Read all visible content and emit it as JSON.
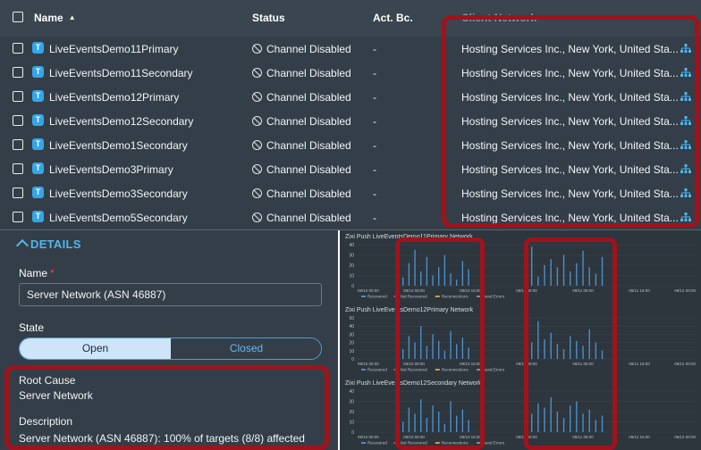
{
  "table": {
    "columns": {
      "name": "Name",
      "status": "Status",
      "act": "Act. Bc.",
      "network": "Client Network"
    },
    "rows": [
      {
        "name": "LiveEventsDemo11Primary",
        "status": "Channel Disabled",
        "act": "-",
        "network": "Hosting Services Inc., New York, United Sta..."
      },
      {
        "name": "LiveEventsDemo11Secondary",
        "status": "Channel Disabled",
        "act": "-",
        "network": "Hosting Services Inc., New York, United Sta..."
      },
      {
        "name": "LiveEventsDemo12Primary",
        "status": "Channel Disabled",
        "act": "-",
        "network": "Hosting Services Inc., New York, United Sta..."
      },
      {
        "name": "LiveEventsDemo12Secondary",
        "status": "Channel Disabled",
        "act": "-",
        "network": "Hosting Services Inc., New York, United Sta..."
      },
      {
        "name": "LiveEventsDemo1Secondary",
        "status": "Channel Disabled",
        "act": "-",
        "network": "Hosting Services Inc., New York, United Sta..."
      },
      {
        "name": "LiveEventsDemo3Primary",
        "status": "Channel Disabled",
        "act": "-",
        "network": "Hosting Services Inc., New York, United Sta..."
      },
      {
        "name": "LiveEventsDemo3Secondary",
        "status": "Channel Disabled",
        "act": "-",
        "network": "Hosting Services Inc., New York, United Sta..."
      },
      {
        "name": "LiveEventsDemo5Secondary",
        "status": "Channel Disabled",
        "act": "-",
        "network": "Hosting Services Inc., New York, United Sta..."
      }
    ],
    "row_icon_letter": "T",
    "row_icon_color": "#33a6e8"
  },
  "details": {
    "title": "DETAILS",
    "name_label": "Name",
    "required_mark": "*",
    "name_value": "Server Network (ASN 46887)",
    "state_label": "State",
    "state_options": [
      "Open",
      "Closed"
    ],
    "state_selected": "Open",
    "root_cause_label": "Root Cause",
    "root_cause_value": "Server Network",
    "description_label": "Description",
    "description_value": "Server Network (ASN 46887): 100% of targets (8/8) affected"
  },
  "colors": {
    "panel_bg": "#343e48",
    "accent": "#4fb6ee",
    "highlight": "#a0131c",
    "bar": "#4a90c8"
  },
  "chart_data": [
    {
      "type": "bar",
      "title": "Zixi Push LiveEventsDemo11Primary Network",
      "x": [
        "09/10 00:00",
        "09/10 08:00",
        "09/10 16:00",
        "09/11 00:00",
        "09/11 08:00",
        "09/11 16:00",
        "09/12 00:00"
      ],
      "yticks": [
        0,
        10,
        20,
        30,
        40
      ],
      "ylim": [
        0,
        40
      ],
      "legend": [
        "Recovered",
        "Not Recovered",
        "Reconnections",
        "Send Errors"
      ],
      "series": [
        {
          "name": "Recovered",
          "values": [
            8,
            22,
            35,
            14,
            28,
            10,
            18,
            30,
            12,
            6,
            24,
            16,
            38,
            9,
            20,
            26,
            18,
            30,
            14,
            22,
            34,
            18,
            12,
            28
          ]
        }
      ]
    },
    {
      "type": "bar",
      "title": "Zixi Push LiveEventsDemo12Primary Network",
      "x": [
        "09/10 00:00",
        "09/10 08:00",
        "09/10 16:00",
        "09/11 00:00",
        "09/11 08:00",
        "09/11 16:00",
        "09/12 00:00"
      ],
      "yticks": [
        0,
        10,
        20,
        30,
        40,
        50
      ],
      "ylim": [
        0,
        50
      ],
      "legend": [
        "Recovered",
        "Not Recovered",
        "Reconnections",
        "Send Errors"
      ],
      "series": [
        {
          "name": "Recovered",
          "values": [
            12,
            28,
            20,
            40,
            16,
            30,
            22,
            10,
            34,
            18,
            26,
            14,
            20,
            46,
            24,
            32,
            18,
            12,
            28,
            22,
            16,
            36,
            20,
            10
          ]
        }
      ]
    },
    {
      "type": "bar",
      "title": "Zixi Push LiveEventsDemo12Secondary Network",
      "x": [
        "09/10 00:00",
        "09/10 08:00",
        "09/10 16:00",
        "09/11 00:00",
        "09/11 08:00",
        "09/11 16:00",
        "09/12 00:00"
      ],
      "yticks": [
        0,
        10,
        20,
        30,
        40
      ],
      "ylim": [
        0,
        40
      ],
      "legend": [
        "Recovered",
        "Not Recovered",
        "Reconnections",
        "Send Errors"
      ],
      "series": [
        {
          "name": "Recovered",
          "values": [
            10,
            24,
            18,
            32,
            14,
            26,
            20,
            8,
            30,
            16,
            22,
            12,
            18,
            28,
            24,
            34,
            20,
            14,
            26,
            30,
            18,
            22,
            12,
            16
          ]
        }
      ]
    }
  ]
}
